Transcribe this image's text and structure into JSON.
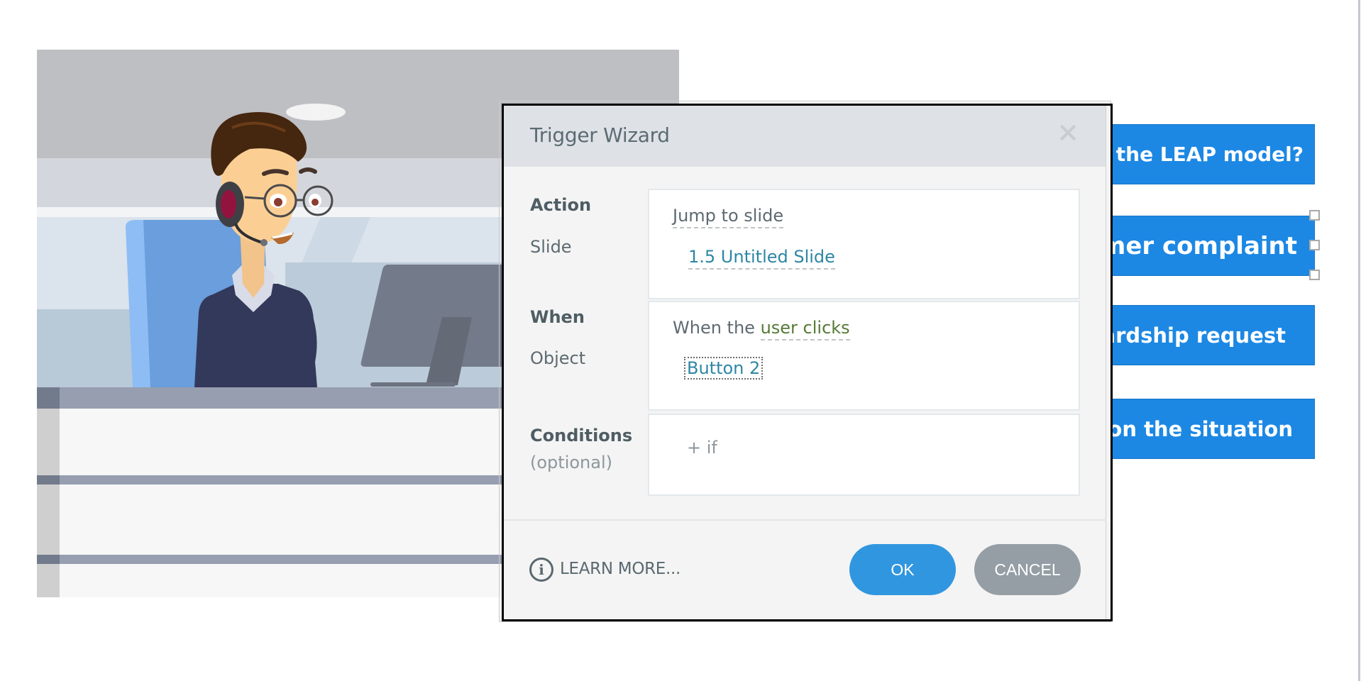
{
  "slide": {
    "answer_buttons": [
      {
        "id": "button-1",
        "label": "What is the LEAP model?"
      },
      {
        "id": "button-2",
        "label": "Handle a customer complaint",
        "selected": true
      },
      {
        "id": "button-3",
        "label": "Handle a hardship request"
      },
      {
        "id": "button-4",
        "label": "Reflect on the situation"
      }
    ],
    "colors": {
      "answer_button": "#1c88e4",
      "chair": "#6a9edc",
      "sweater": "#33395a",
      "hair": "#45260f",
      "skin": "#fbcf94",
      "headset_cup": "#93133f"
    }
  },
  "dialog": {
    "title": "Trigger Wizard",
    "close_icon": "close-x-icon",
    "rows": {
      "action": {
        "label": "Action",
        "value": "Jump to slide"
      },
      "slide": {
        "label": "Slide",
        "value": "1.5 Untitled Slide"
      },
      "when": {
        "label": "When",
        "prefix": "When the",
        "value": "user clicks"
      },
      "object": {
        "label": "Object",
        "value": "Button 2"
      },
      "conditions": {
        "label": "Conditions",
        "sublabel": "(optional)",
        "add_label": "+ if"
      }
    },
    "footer": {
      "info_icon": "info-circle-icon",
      "info_glyph": "i",
      "learn_more": "LEARN MORE...",
      "ok": "OK",
      "cancel": "CANCEL"
    },
    "colors": {
      "ok": "#3196e0",
      "cancel": "#959ea5",
      "link_teal": "#2e86a4",
      "event_green": "#557a35",
      "header_bg": "#dee2e6"
    }
  }
}
